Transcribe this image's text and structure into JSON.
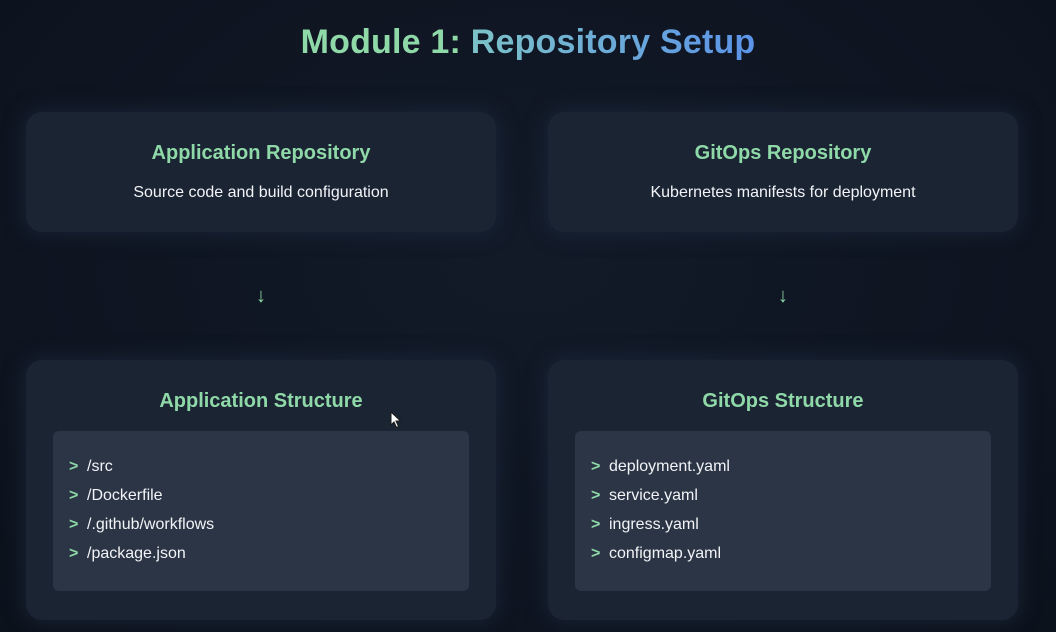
{
  "title": {
    "part1": "Module 1:",
    "part2": "Repository Setup"
  },
  "colors": {
    "accent_green": "#8fd9a8",
    "accent_blue": "#5b93e8",
    "card_bg": "#1b2433",
    "file_box_bg": "#2b3545",
    "page_bg": "#0f1521"
  },
  "cards": {
    "app_repo": {
      "title": "Application Repository",
      "desc": "Source code and build configuration"
    },
    "gitops_repo": {
      "title": "GitOps Repository",
      "desc": "Kubernetes manifests for deployment"
    },
    "app_structure": {
      "title": "Application Structure",
      "files": [
        "/src",
        "/Dockerfile",
        "/.github/workflows",
        "/package.json"
      ]
    },
    "gitops_structure": {
      "title": "GitOps Structure",
      "files": [
        "deployment.yaml",
        "service.yaml",
        "ingress.yaml",
        "configmap.yaml"
      ]
    }
  },
  "icons": {
    "arrow": "arrow-down-icon",
    "bullet": "chevron-right-icon",
    "bullet_glyph": ">",
    "arrow_glyph": "↓"
  }
}
